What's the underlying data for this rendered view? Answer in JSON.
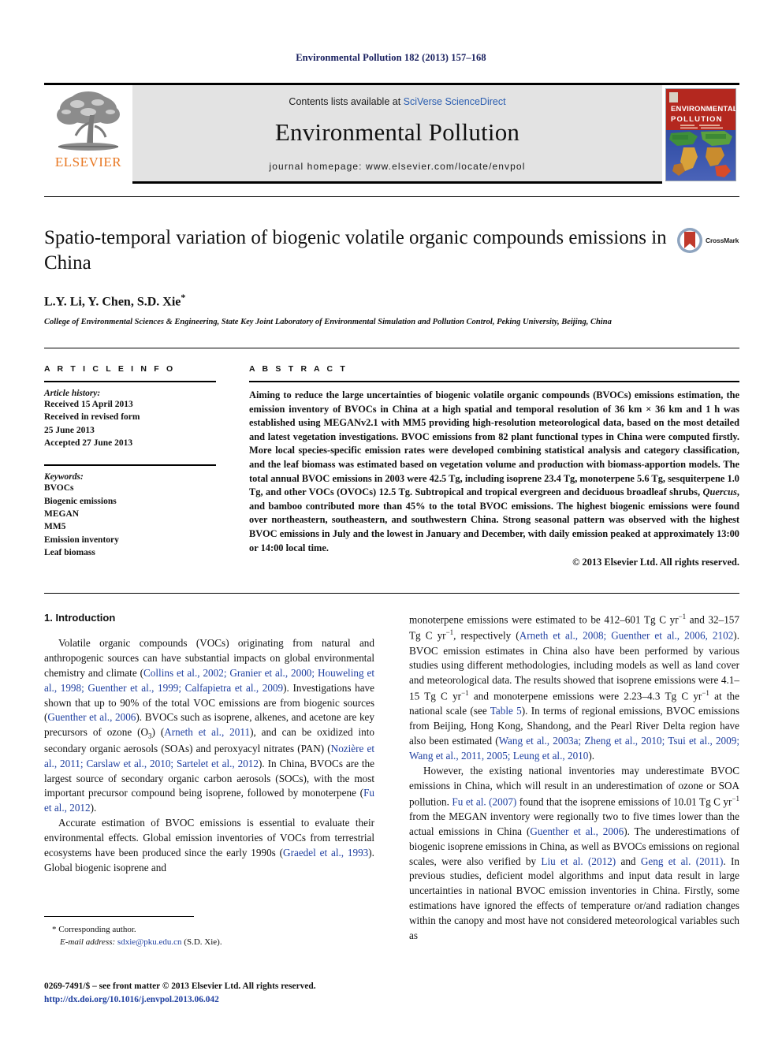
{
  "running_head": "Environmental Pollution 182 (2013) 157–168",
  "masthead": {
    "publisher_logo_text": "ELSEVIER",
    "contents_prefix": "Contents lists available at ",
    "contents_link": "SciVerse ScienceDirect",
    "journal_name": "Environmental Pollution",
    "homepage": "journal homepage: www.elsevier.com/locate/envpol",
    "cover_title_line1": "ENVIRONMENTAL",
    "cover_title_line2": "POLLUTION"
  },
  "article": {
    "title": "Spatio-temporal variation of biogenic volatile organic compounds emissions in China",
    "authors": "L.Y. Li, Y. Chen, S.D. Xie",
    "corresponding_marker": "*",
    "affiliation": "College of Environmental Sciences & Engineering, State Key Joint Laboratory of Environmental Simulation and Pollution Control, Peking University, Beijing, China",
    "crossmark_label": "CrossMark"
  },
  "article_info": {
    "heading": "A R T I C L E  I N F O",
    "history_label": "Article history:",
    "history": [
      "Received 15 April 2013",
      "Received in revised form",
      "25 June 2013",
      "Accepted 27 June 2013"
    ],
    "keywords_label": "Keywords:",
    "keywords": [
      "BVOCs",
      "Biogenic emissions",
      "MEGAN",
      "MM5",
      "Emission inventory",
      "Leaf biomass"
    ]
  },
  "abstract": {
    "heading": "A B S T R A C T",
    "text": "Aiming to reduce the large uncertainties of biogenic volatile organic compounds (BVOCs) emissions estimation, the emission inventory of BVOCs in China at a high spatial and temporal resolution of 36 km × 36 km and 1 h was established using MEGANv2.1 with MM5 providing high-resolution meteorological data, based on the most detailed and latest vegetation investigations. BVOC emissions from 82 plant functional types in China were computed firstly. More local species-specific emission rates were developed combining statistical analysis and category classification, and the leaf biomass was estimated based on vegetation volume and production with biomass-apportion models. The total annual BVOC emissions in 2003 were 42.5 Tg, including isoprene 23.4 Tg, monoterpene 5.6 Tg, sesquiterpene 1.0 Tg, and other VOCs (OVOCs) 12.5 Tg. Subtropical and tropical evergreen and deciduous broadleaf shrubs, Quercus, and bamboo contributed more than 45% to the total BVOC emissions. The highest biogenic emissions were found over northeastern, southeastern, and southwestern China. Strong seasonal pattern was observed with the highest BVOC emissions in July and the lowest in January and December, with daily emission peaked at approximately 13:00 or 14:00 local time.",
    "italic_term": "Quercus",
    "copyright": "© 2013 Elsevier Ltd. All rights reserved."
  },
  "introduction": {
    "heading": "1. Introduction",
    "left_paragraphs": [
      "Volatile organic compounds (VOCs) originating from natural and anthropogenic sources can have substantial impacts on global environmental chemistry and climate (Collins et al., 2002; Granier et al., 2000; Houweling et al., 1998; Guenther et al., 1999; Calfapietra et al., 2009). Investigations have shown that up to 90% of the total VOC emissions are from biogenic sources (Guenther et al., 2006). BVOCs such as isoprene, alkenes, and acetone are key precursors of ozone (O3) (Arneth et al., 2011), and can be oxidized into secondary organic aerosols (SOAs) and peroxyacyl nitrates (PAN) (Nozière et al., 2011; Carslaw et al., 2010; Sartelet et al., 2012). In China, BVOCs are the largest source of secondary organic carbon aerosols (SOCs), with the most important precursor compound being isoprene, followed by monoterpene (Fu et al., 2012).",
      "Accurate estimation of BVOC emissions is essential to evaluate their environmental effects. Global emission inventories of VOCs from terrestrial ecosystems have been produced since the early 1990s (Graedel et al., 1993). Global biogenic isoprene and"
    ],
    "right_paragraphs": [
      "monoterpene emissions were estimated to be 412–601 Tg C yr−1 and 32–157 Tg C yr−1, respectively (Arneth et al., 2008; Guenther et al., 2006, 2102). BVOC emission estimates in China also have been performed by various studies using different methodologies, including models as well as land cover and meteorological data. The results showed that isoprene emissions were 4.1–15 Tg C yr−1 and monoterpene emissions were 2.23–4.3 Tg C yr−1 at the national scale (see Table 5). In terms of regional emissions, BVOC emissions from Beijing, Hong Kong, Shandong, and the Pearl River Delta region have also been estimated (Wang et al., 2003a; Zheng et al., 2010; Tsui et al., 2009; Wang et al., 2011, 2005; Leung et al., 2010).",
      "However, the existing national inventories may underestimate BVOC emissions in China, which will result in an underestimation of ozone or SOA pollution. Fu et al. (2007) found that the isoprene emissions of 10.01 Tg C yr−1 from the MEGAN inventory were regionally two to five times lower than the actual emissions in China (Guenther et al., 2006). The underestimations of biogenic isoprene emissions in China, as well as BVOCs emissions on regional scales, were also verified by Liu et al. (2012) and Geng et al. (2011). In previous studies, deficient model algorithms and input data result in large uncertainties in national BVOC emission inventories in China. Firstly, some estimations have ignored the effects of temperature or/and radiation changes within the canopy and most have not considered meteorological variables such as"
    ]
  },
  "footnotes": {
    "corresponding": "* Corresponding author.",
    "email_label": "E-mail address:",
    "email": "sdxie@pku.edu.cn",
    "email_suffix": "(S.D. Xie).",
    "frontmatter": "0269-7491/$ – see front matter © 2013 Elsevier Ltd. All rights reserved.",
    "doi": "http://dx.doi.org/10.1016/j.envpol.2013.06.042"
  },
  "colors": {
    "link": "#2a5db0",
    "citation": "#2040a0",
    "elsevier_orange": "#e87722",
    "running_head": "#1a2160"
  }
}
